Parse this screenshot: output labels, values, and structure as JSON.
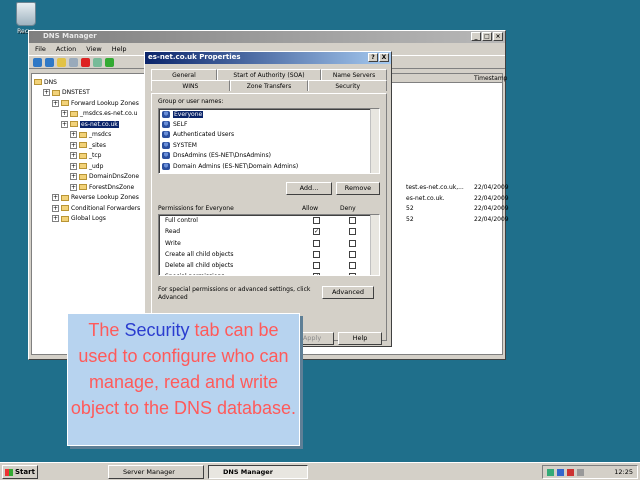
{
  "desktop": {
    "recycle_label": "Recyc"
  },
  "manager": {
    "title": "DNS Manager",
    "menu": [
      "File",
      "Action",
      "View",
      "Help"
    ],
    "tree": [
      {
        "label": "DNS",
        "indent": 0
      },
      {
        "label": "DNSTEST",
        "indent": 1
      },
      {
        "label": "Forward Lookup Zones",
        "indent": 2
      },
      {
        "label": "_msdcs.es-net.co.u",
        "indent": 3
      },
      {
        "label": "es-net.co.uk",
        "indent": 3,
        "selected": true
      },
      {
        "label": "_msdcs",
        "indent": 4
      },
      {
        "label": "_sites",
        "indent": 4
      },
      {
        "label": "_tcp",
        "indent": 4
      },
      {
        "label": "_udp",
        "indent": 4
      },
      {
        "label": "DomainDnsZone",
        "indent": 4
      },
      {
        "label": "ForestDnsZone",
        "indent": 4
      },
      {
        "label": "Reverse Lookup Zones",
        "indent": 2
      },
      {
        "label": "Conditional Forwarders",
        "indent": 2
      },
      {
        "label": "Global Logs",
        "indent": 2
      }
    ],
    "list_header_timestamp": "Timestamp",
    "list_rows": [
      {
        "data": "test.es-net.co.uk,...",
        "ts": "22/04/2009"
      },
      {
        "data": "es-net.co.uk.",
        "ts": "22/04/2009"
      },
      {
        "data": "52",
        "ts": "22/04/2009"
      },
      {
        "data": "52",
        "ts": "22/04/2009"
      }
    ]
  },
  "dialog": {
    "title": "es-net.co.uk Properties",
    "tabs_row1": [
      "General",
      "Start of Authority (SOA)",
      "Name Servers"
    ],
    "tabs_row2": [
      "WINS",
      "Zone Transfers",
      "Security"
    ],
    "group_label": "Group or user names:",
    "users": [
      "Everyone",
      "SELF",
      "Authenticated Users",
      "SYSTEM",
      "DnsAdmins (ES-NET\\DnsAdmins)",
      "Domain Admins (ES-NET\\Domain Admins)"
    ],
    "add_btn": "Add...",
    "remove_btn": "Remove",
    "perm_label": "Permissions for Everyone",
    "allow_label": "Allow",
    "deny_label": "Deny",
    "permissions": [
      {
        "name": "Full control",
        "allow": false,
        "deny": false
      },
      {
        "name": "Read",
        "allow": true,
        "deny": false
      },
      {
        "name": "Write",
        "allow": false,
        "deny": false
      },
      {
        "name": "Create all child objects",
        "allow": false,
        "deny": false
      },
      {
        "name": "Delete all child objects",
        "allow": false,
        "deny": false
      },
      {
        "name": "Special permissions",
        "allow": true,
        "deny": false
      }
    ],
    "special_note": "For special permissions or advanced settings, click Advanced",
    "advanced_btn": "Advanced",
    "apply_btn": "Apply",
    "help_btn": "Help",
    "help_q": "?",
    "close_x": "X"
  },
  "callout": {
    "pre": "The ",
    "highlight": "Security",
    "post": " tab can be used to configure who can manage, read and write object to the DNS database."
  },
  "taskbar": {
    "start": "Start",
    "tasks": [
      "Server Manager",
      "DNS Manager"
    ],
    "clock": "12:25"
  }
}
